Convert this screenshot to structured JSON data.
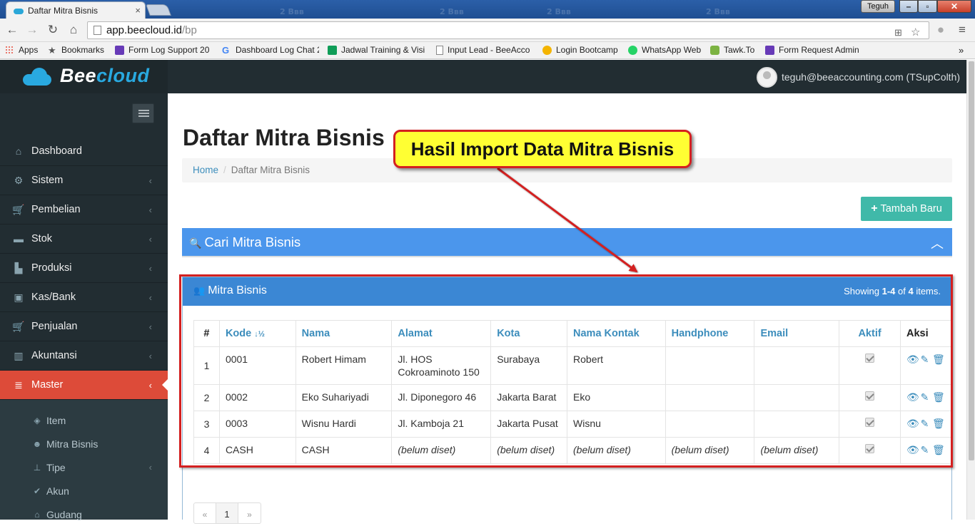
{
  "browser": {
    "tab_title": "Daftar Mitra Bisnis",
    "tab_close": "×",
    "profile_name": "Teguh",
    "url_host": "app.beecloud.id",
    "url_path": "/bp",
    "bookmarks": [
      {
        "label": "Apps",
        "icon": "apps-grid-icon",
        "color": "#e84c3d"
      },
      {
        "label": "Bookmarks",
        "icon": "star-icon",
        "color": "#555555"
      },
      {
        "label": "Form Log Support 20",
        "icon": "form-icon",
        "color": "#673ab7"
      },
      {
        "label": "Dashboard Log Chat 2",
        "icon": "google-icon",
        "color": "#4285f4"
      },
      {
        "label": "Jadwal Training & Visi",
        "icon": "sheet-icon",
        "color": "#0f9d58"
      },
      {
        "label": "Input Lead - BeeAcco",
        "icon": "page-icon",
        "color": "#888888"
      },
      {
        "label": "Login Bootcamp",
        "icon": "hand-icon",
        "color": "#f4b400"
      },
      {
        "label": "WhatsApp Web",
        "icon": "whatsapp-icon",
        "color": "#25d366"
      },
      {
        "label": "Tawk.To",
        "icon": "tawk-icon",
        "color": "#7cb342"
      },
      {
        "label": "Form Request Admin",
        "icon": "form-icon",
        "color": "#673ab7"
      }
    ],
    "bookmarks_more": "»"
  },
  "app": {
    "logo_part1": "Bee",
    "logo_part2": "cloud",
    "user": "teguh@beeaccounting.com (TSupColth)"
  },
  "sidebar": {
    "items": [
      {
        "label": "Dashboard",
        "icon": "home-icon",
        "glyph": "⌂",
        "has_children": false
      },
      {
        "label": "Sistem",
        "icon": "cogs-icon",
        "glyph": "⚙",
        "has_children": true
      },
      {
        "label": "Pembelian",
        "icon": "cart-icon",
        "glyph": "🛒",
        "has_children": true
      },
      {
        "label": "Stok",
        "icon": "box-icon",
        "glyph": "▬",
        "has_children": true
      },
      {
        "label": "Produksi",
        "icon": "industry-icon",
        "glyph": "▙",
        "has_children": true
      },
      {
        "label": "Kas/Bank",
        "icon": "money-icon",
        "glyph": "▣",
        "has_children": true
      },
      {
        "label": "Penjualan",
        "icon": "cart-icon",
        "glyph": "🛒",
        "has_children": true
      },
      {
        "label": "Akuntansi",
        "icon": "bar-chart-icon",
        "glyph": "▥",
        "has_children": true
      },
      {
        "label": "Master",
        "icon": "database-icon",
        "glyph": "≣",
        "has_children": true,
        "active": true
      }
    ],
    "sub_items": [
      {
        "label": "Item",
        "icon": "cube-icon",
        "glyph": "◈",
        "has_children": false
      },
      {
        "label": "Mitra Bisnis",
        "icon": "users-icon",
        "glyph": "☻",
        "has_children": false
      },
      {
        "label": "Tipe",
        "icon": "sitemap-icon",
        "glyph": "⊥",
        "has_children": true
      },
      {
        "label": "Akun",
        "icon": "check-icon",
        "glyph": "✔",
        "has_children": false
      },
      {
        "label": "Gudang",
        "icon": "warehouse-icon",
        "glyph": "⌂",
        "has_children": false
      }
    ],
    "chevron": "‹"
  },
  "page": {
    "title": "Daftar Mitra Bisnis",
    "breadcrumb": {
      "home": "Home",
      "sep": "/",
      "current": "Daftar Mitra Bisnis"
    },
    "add_button": "Tambah Baru",
    "add_button_plus": "+",
    "search_title": "Cari Mitra Bisnis",
    "search_toggle": "︿"
  },
  "grid": {
    "title": "Mitra Bisnis",
    "summary_prefix": "Showing ",
    "summary_range": "1-4",
    "summary_of": " of ",
    "summary_total": "4",
    "summary_suffix": " items.",
    "columns": [
      "#",
      "Kode",
      "Nama",
      "Alamat",
      "Kota",
      "Nama Kontak",
      "Handphone",
      "Email",
      "Aktif",
      "Aksi"
    ],
    "sort_indicator": "↓½",
    "rows": [
      {
        "no": "1",
        "kode": "0001",
        "nama": "Robert Himam",
        "alamat": "Jl. HOS Cokroaminoto 150",
        "kota": "Surabaya",
        "kontak": "Robert",
        "handphone": "",
        "email": "",
        "aktif": true
      },
      {
        "no": "2",
        "kode": "0002",
        "nama": "Eko Suhariyadi",
        "alamat": "Jl. Diponegoro 46",
        "kota": "Jakarta Barat",
        "kontak": "Eko",
        "handphone": "",
        "email": "",
        "aktif": true
      },
      {
        "no": "3",
        "kode": "0003",
        "nama": "Wisnu Hardi",
        "alamat": "Jl. Kamboja 21",
        "kota": "Jakarta Pusat",
        "kontak": "Wisnu",
        "handphone": "",
        "email": "",
        "aktif": true
      },
      {
        "no": "4",
        "kode": "CASH",
        "nama": "CASH",
        "alamat": "(belum diset)",
        "kota": "(belum diset)",
        "kontak": "(belum diset)",
        "handphone": "(belum diset)",
        "email": "(belum diset)",
        "aktif": true,
        "unset": true
      }
    ],
    "pager": [
      "«",
      "1",
      "»"
    ]
  },
  "annotation": {
    "callout_text": "Hasil Import Data Mitra Bisnis",
    "color": "#d42020",
    "callout_fill": "#ffff33"
  },
  "colors": {
    "sidebar_bg": "#222d32",
    "active_menu": "#dd4b39",
    "search_header": "#4b96ec",
    "grid_header": "#3b87d4",
    "add_button": "#40b9a9",
    "link": "#3c8dbc"
  }
}
